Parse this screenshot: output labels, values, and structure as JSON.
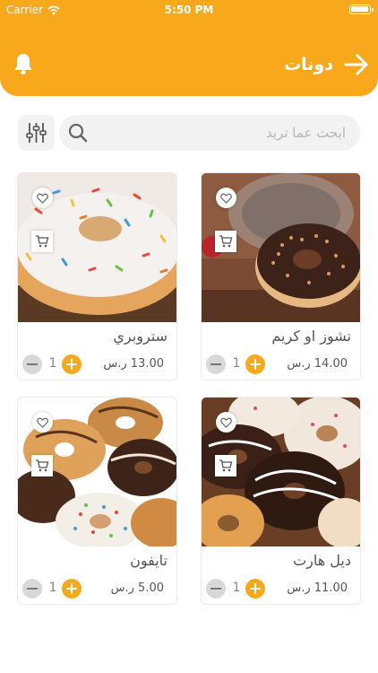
{
  "status_bar": {
    "carrier": "Carrier",
    "time": "5:50 PM",
    "battery_level": 1.0
  },
  "header": {
    "title": "دونات",
    "back_icon": "arrow-right-icon",
    "notification_icon": "bell-icon"
  },
  "search": {
    "placeholder": "ابحث عما تريد",
    "value": ""
  },
  "colors": {
    "accent": "#f8a81b",
    "header_bg": "#f8a81b",
    "card_border": "#ececec",
    "minus_bg": "#d8d8d8"
  },
  "products": [
    {
      "name": "تشوز او كريم",
      "price": "14.00 ر.س",
      "quantity": "1"
    },
    {
      "name": "ستروبري",
      "price": "13.00 ر.س",
      "quantity": "1"
    },
    {
      "name": "ديل هارت",
      "price": "11.00 ر.س",
      "quantity": "1"
    },
    {
      "name": "تايفون",
      "price": "5.00 ر.س",
      "quantity": "1"
    }
  ]
}
